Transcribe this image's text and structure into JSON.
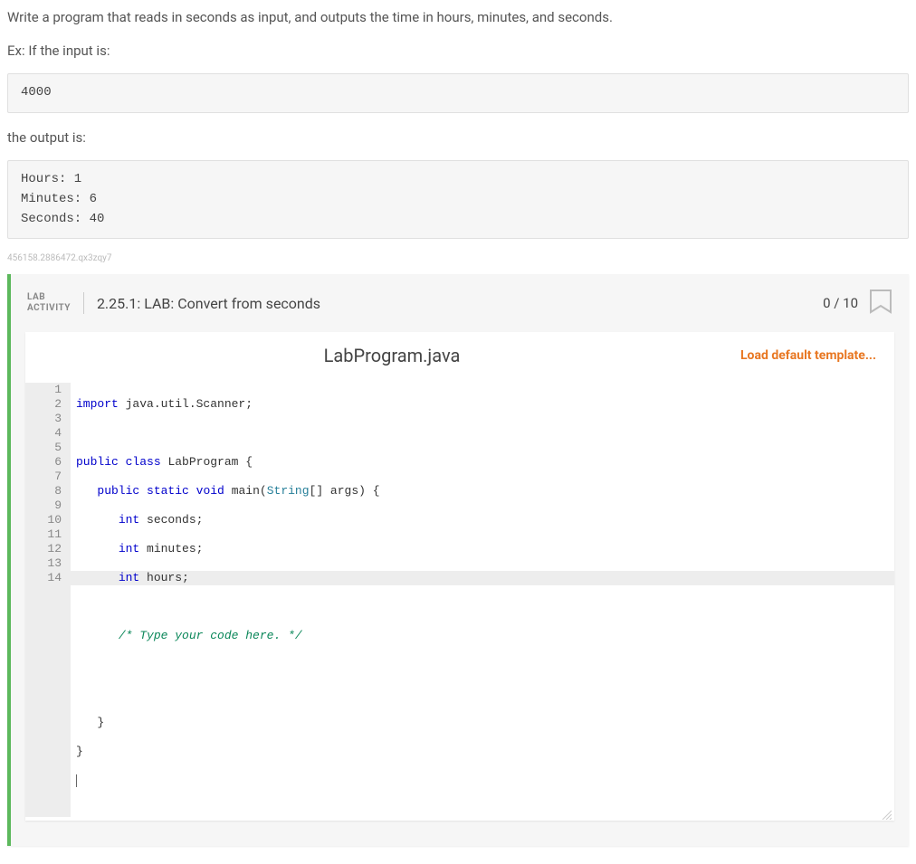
{
  "problem": {
    "description": "Write a program that reads in seconds as input, and outputs the time in hours, minutes, and seconds.",
    "example_input_label": "Ex: If the input is:",
    "example_input": "4000",
    "example_output_label": "the output is:",
    "example_output": "Hours: 1\nMinutes: 6\nSeconds: 40",
    "internal_id": "456158.2886472.qx3zqy7"
  },
  "lab": {
    "badge_line1": "LAB",
    "badge_line2": "ACTIVITY",
    "title": "2.25.1: LAB: Convert from seconds",
    "score": "0 / 10"
  },
  "editor": {
    "filename": "LabProgram.java",
    "load_template_label": "Load default template...",
    "line_count": 14,
    "active_line": 14,
    "code": {
      "l1": {
        "import_kw": "import",
        "rest": " java.util.Scanner;"
      },
      "l3": {
        "public_kw": "public",
        "class_kw": "class",
        "name": "LabProgram",
        "brace": " {"
      },
      "l4": {
        "indent": "   ",
        "public_kw": "public",
        "static_kw": "static",
        "void_kw": "void",
        "main": "main",
        "paren_open": "(",
        "string_type": "String",
        "args": "[] args) {"
      },
      "l5": {
        "indent": "      ",
        "int_kw": "int",
        "rest": " seconds;"
      },
      "l6": {
        "indent": "      ",
        "int_kw": "int",
        "rest": " minutes;"
      },
      "l7": {
        "indent": "      ",
        "int_kw": "int",
        "rest": " hours;"
      },
      "l9": {
        "indent": "      ",
        "comment": "/* Type your code here. */"
      },
      "l12": {
        "indent": "   ",
        "brace": "}"
      },
      "l13": {
        "brace": "}"
      }
    }
  }
}
